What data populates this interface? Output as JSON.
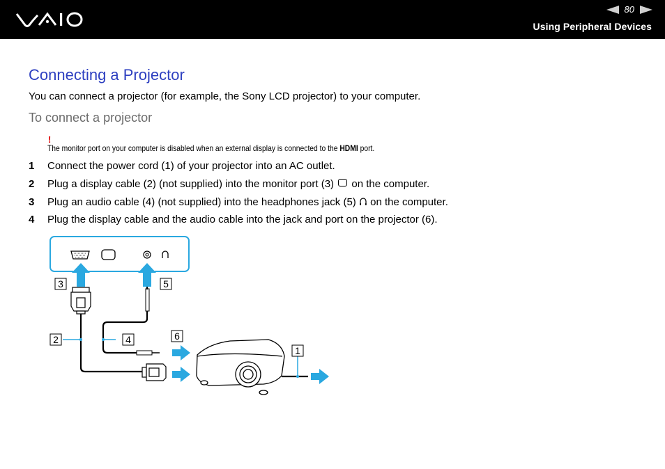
{
  "header": {
    "logo": "VAIO",
    "page_number": "80",
    "prev_icon": "prev-page-arrow-icon",
    "next_icon": "next-page-arrow-icon",
    "section": "Using Peripheral Devices"
  },
  "content": {
    "title": "Connecting a Projector",
    "intro": "You can connect a projector (for example, the Sony LCD projector) to your computer.",
    "subheading": "To connect a projector",
    "note": {
      "mark": "!",
      "text_before": "The monitor port on your computer is disabled when an external display is connected to the ",
      "bold": "HDMI",
      "text_after": " port."
    },
    "steps": [
      {
        "num": "1",
        "text": "Connect the power cord (1) of your projector into an AC outlet."
      },
      {
        "num": "2",
        "text_before": "Plug a display cable (2) (not supplied) into the monitor port (3) ",
        "icon": "monitor-port-icon",
        "text_after": " on the computer."
      },
      {
        "num": "3",
        "text_before": "Plug an audio cable (4) (not supplied) into the headphones jack (5) ",
        "icon": "headphones-icon",
        "text_after": " on the computer."
      },
      {
        "num": "4",
        "text": "Plug the display cable and the audio cable into the jack and port on the projector (6)."
      }
    ]
  },
  "diagram": {
    "callouts": [
      "1",
      "2",
      "3",
      "4",
      "5",
      "6"
    ],
    "colors": {
      "accent": "#2aa8e0",
      "title": "#2d3fc0",
      "warning": "#e00000"
    }
  }
}
